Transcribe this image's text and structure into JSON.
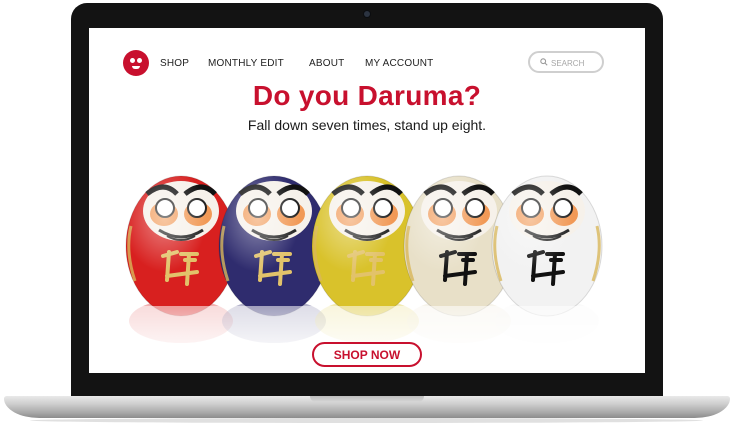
{
  "nav": {
    "items": [
      {
        "label": "SHOP"
      },
      {
        "label": "MONTHLY EDIT"
      },
      {
        "label": "ABOUT"
      },
      {
        "label": "MY ACCOUNT"
      }
    ]
  },
  "search": {
    "placeholder": "SEARCH",
    "icon": "search-icon"
  },
  "hero": {
    "headline": "Do you Daruma?",
    "tagline": "Fall down seven times, stand up eight.",
    "daruma_colors": [
      "#d8201f",
      "#2f2c6e",
      "#d9c22b",
      "#e8e0c8",
      "#f2f2f2"
    ]
  },
  "cta": {
    "label": "SHOP NOW"
  },
  "brand": {
    "accent": "#c8102e"
  }
}
